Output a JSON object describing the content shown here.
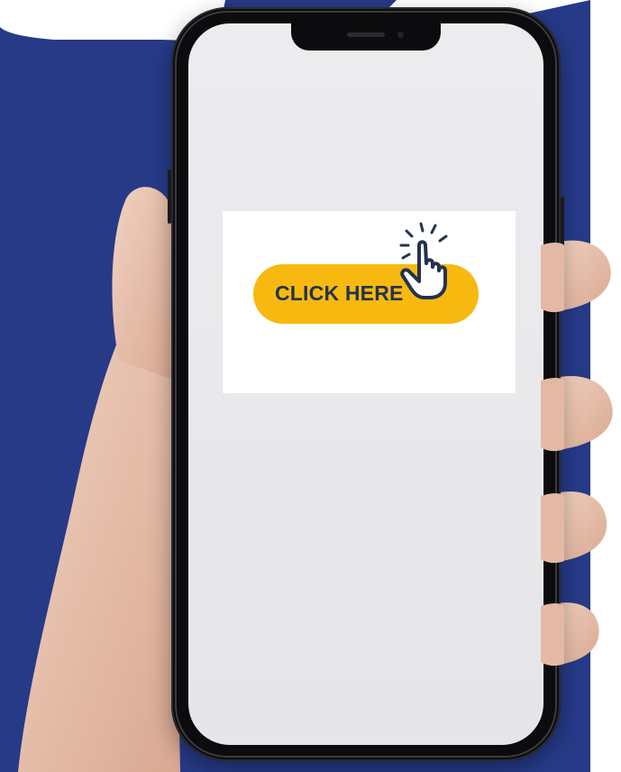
{
  "cta": {
    "label": "CLICK HERE"
  },
  "colors": {
    "background_blue": "#263a87",
    "button_yellow": "#f7b90f",
    "label_navy": "#23324f",
    "screen": "#e9e9ec"
  },
  "icons": {
    "pointer": "hand-pointer-click-icon",
    "camera": "camera-icon",
    "speaker": "speaker-icon"
  }
}
